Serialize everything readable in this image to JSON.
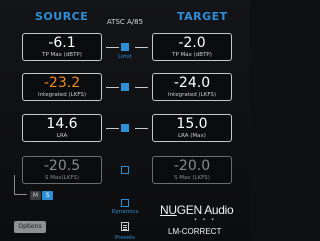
{
  "header": {
    "source_title": "SOURCE",
    "target_title": "TARGET",
    "standard": "ATSC A/85"
  },
  "source": [
    {
      "value": "-6.1",
      "caption": "TP Max (dBTP)"
    },
    {
      "value": "-23.2",
      "caption": "Integrated (LKFS)"
    },
    {
      "value": "14.6",
      "caption": "LRA"
    },
    {
      "value": "-20.5",
      "caption": "S Max(LKFS)"
    }
  ],
  "target": [
    {
      "value": "-2.0",
      "caption": "TP Max (dBTP)"
    },
    {
      "value": "-24.0",
      "caption": "Integrated (LKFS)"
    },
    {
      "value": "15.0",
      "caption": "LRA (Max)"
    },
    {
      "value": "-20.0",
      "caption": "S Max (LKFS)"
    }
  ],
  "center": {
    "limit_label": "Limit",
    "dynamics_label": "Dynamics",
    "presets_label": "Presets"
  },
  "mode": {
    "m_label": "M",
    "s_label": "S",
    "selected": "S"
  },
  "footer": {
    "options_label": "Options",
    "brand_part1": "NU",
    "brand_part2": "GEN",
    "brand_part3": " Audio",
    "dots": "• • •",
    "product": "LM-CORRECT"
  },
  "colors": {
    "accent": "#2e8fd8",
    "warning": "#f28a1c",
    "background": "#0f1012"
  }
}
